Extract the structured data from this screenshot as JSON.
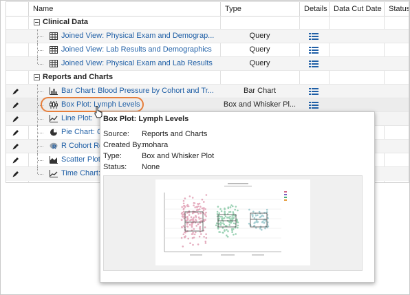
{
  "columns": [
    "Name",
    "Type",
    "Details",
    "Data Cut Date",
    "Status."
  ],
  "groups": [
    {
      "label": "Clinical Data"
    },
    {
      "label": "Reports and Charts"
    }
  ],
  "rows": [
    {
      "name": "Joined View: Physical Exam and Demograp...",
      "type": "Query",
      "icon": "grid-icon"
    },
    {
      "name": "Joined View: Lab Results and Demographics",
      "type": "Query",
      "icon": "grid-icon"
    },
    {
      "name": "Joined View: Physical Exam and Lab Results",
      "type": "Query",
      "icon": "grid-icon"
    },
    {
      "name": "Bar Chart: Blood Pressure by Cohort and Tr...",
      "type": "Bar Chart",
      "icon": "bar-chart-icon"
    },
    {
      "name": "Box Plot: Lymph Levels",
      "type": "Box and Whisker Pl...",
      "icon": "box-plot-icon"
    },
    {
      "name": "Line Plot:",
      "type": "",
      "icon": "line-chart-icon"
    },
    {
      "name": "Pie Chart: C",
      "type": "",
      "icon": "pie-chart-icon"
    },
    {
      "name": "R Cohort Re",
      "type": "",
      "icon": "r-icon"
    },
    {
      "name": "Scatter Plot",
      "type": "",
      "icon": "area-chart-icon"
    },
    {
      "name": "Time Chart:",
      "type": "",
      "icon": "time-chart-icon"
    }
  ],
  "popup": {
    "title": "Box Plot: Lymph Levels",
    "source_label": "Source:",
    "source_value": "Reports and Charts",
    "created_label": "Created By:",
    "created_value": "mohara",
    "type_label": "Type:",
    "type_value": "Box and Whisker Plot",
    "status_label": "Status:",
    "status_value": "None"
  },
  "colors": {
    "link": "#1f5fa6",
    "highlight_oval": "#e67e3b",
    "detail_icon": "#1f5fa6"
  }
}
